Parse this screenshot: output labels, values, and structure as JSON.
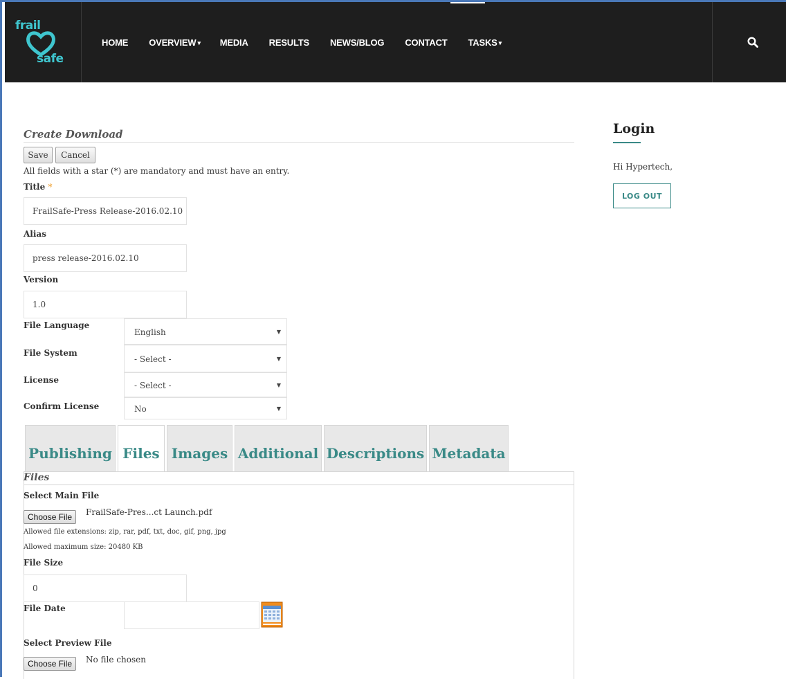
{
  "nav": {
    "logo_top": "frail",
    "logo_bottom": "safe",
    "items": [
      {
        "label": "HOME",
        "caret": ""
      },
      {
        "label": "OVERVIEW",
        "caret": "▾"
      },
      {
        "label": "MEDIA",
        "caret": ""
      },
      {
        "label": "RESULTS",
        "caret": ""
      },
      {
        "label": "NEWS/BLOG",
        "caret": ""
      },
      {
        "label": "CONTACT",
        "caret": ""
      },
      {
        "label": "TASKS",
        "caret": "▾"
      }
    ],
    "search_icon": "search-icon"
  },
  "form": {
    "title": "Create Download",
    "save_label": "Save",
    "cancel_label": "Cancel",
    "hint": "All fields with a star (*) are mandatory and must have an entry.",
    "title_label": "Title",
    "title_star": "*",
    "title_value": "FrailSafe-Press Release-2016.02.10",
    "alias_label": "Alias",
    "alias_value": "press release-2016.02.10",
    "version_label": "Version",
    "version_value": "1.0",
    "file_language_label": "File Language",
    "file_language_value": "English",
    "file_system_label": "File System",
    "file_system_value": "- Select -",
    "license_label": "License",
    "license_value": "- Select -",
    "confirm_license_label": "Confirm License",
    "confirm_license_value": "No"
  },
  "tabs": [
    {
      "label": "Publishing"
    },
    {
      "label": "Files"
    },
    {
      "label": "Images"
    },
    {
      "label": "Additional"
    },
    {
      "label": "Descriptions"
    },
    {
      "label": "Metadata"
    }
  ],
  "files_panel": {
    "title": "Files",
    "main_file_label": "Select Main File",
    "choose_file_label": "Choose File",
    "main_file_name": "FrailSafe-Pres...ct Launch.pdf",
    "allowed_ext": "Allowed file extensions: zip, rar, pdf, txt, doc, gif, png, jpg",
    "allowed_size": "Allowed maximum size: 20480 KB",
    "file_size_label": "File Size",
    "file_size_value": "0",
    "file_date_label": "File Date",
    "preview_file_label": "Select Preview File",
    "preview_choose_label": "Choose File",
    "preview_file_name": "No file chosen"
  },
  "sidebar": {
    "title": "Login",
    "greeting": "Hi Hypertech,",
    "logout_label": "LOG OUT"
  },
  "colors": {
    "accent": "#3a8a87",
    "logo": "#3fc6cf",
    "nav_bg": "#1e1e1e",
    "star": "#f0ad4e"
  }
}
